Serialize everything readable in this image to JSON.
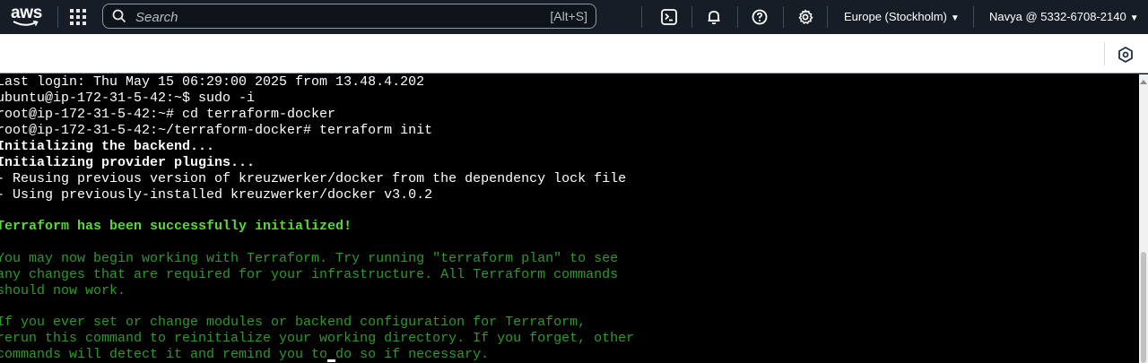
{
  "nav": {
    "logo_text": "aws",
    "search_placeholder": "Search",
    "search_shortcut": "[Alt+S]",
    "region": "Europe (Stockholm)",
    "account": "Navya @ 5332-6708-2140",
    "icons": [
      "services-grid-icon",
      "search-icon",
      "cloudshell-icon",
      "bell-icon",
      "help-icon",
      "settings-icon",
      "chevron-down-icon"
    ]
  },
  "subbar": {
    "icons": [
      "hexagon-settings-icon"
    ]
  },
  "terminal": {
    "lines": [
      "Last login: Thu May 15 06:29:00 2025 from 13.48.4.202",
      "ubuntu@ip-172-31-5-42:~$ sudo -i",
      "root@ip-172-31-5-42:~# cd terraform-docker",
      "root@ip-172-31-5-42:~/terraform-docker# terraform init",
      "Initializing the backend...",
      "Initializing provider plugins...",
      "- Reusing previous version of kreuzwerker/docker from the dependency lock file",
      "- Using previously-installed kreuzwerker/docker v3.0.2",
      "",
      "Terraform has been successfully initialized!",
      "",
      "You may now begin working with Terraform. Try running \"terraform plan\" to see",
      "any changes that are required for your infrastructure. All Terraform commands",
      "should now work.",
      "",
      "If you ever set or change modules or backend configuration for Terraform,",
      "rerun this command to reinitialize your working directory. If you forget, other",
      "commands will detect it and remind you to do so if necessary."
    ]
  },
  "colors": {
    "nav_bg": "#161d26",
    "success_green": "#5ad83a",
    "info_green": "#2c9a2c",
    "aws_smile": "#ff9900"
  }
}
